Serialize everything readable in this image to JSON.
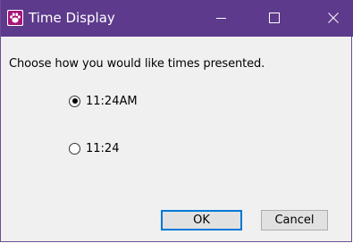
{
  "window": {
    "title": "Time Display",
    "icon": "paw-icon",
    "controls": {
      "minimize_icon": "minimize-icon",
      "maximize_icon": "maximize-icon",
      "close_icon": "close-icon"
    }
  },
  "dialog": {
    "prompt": "Choose how you would like times presented.",
    "options": [
      {
        "label": "11:24AM",
        "checked": true
      },
      {
        "label": "11:24",
        "checked": false
      }
    ],
    "buttons": {
      "ok": "OK",
      "cancel": "Cancel"
    }
  },
  "colors": {
    "titlebar": "#5d3a8c",
    "accent": "#0078d7"
  }
}
